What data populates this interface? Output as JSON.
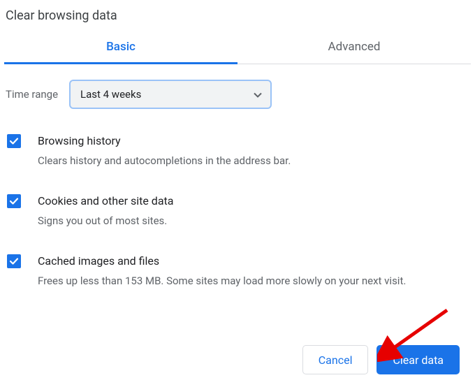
{
  "dialog": {
    "title": "Clear browsing data"
  },
  "tabs": {
    "basic": "Basic",
    "advanced": "Advanced"
  },
  "time": {
    "label": "Time range",
    "value": "Last 4 weeks"
  },
  "options": [
    {
      "label": "Browsing history",
      "description": "Clears history and autocompletions in the address bar."
    },
    {
      "label": "Cookies and other site data",
      "description": "Signs you out of most sites."
    },
    {
      "label": "Cached images and files",
      "description": "Frees up less than 153 MB. Some sites may load more slowly on your next visit."
    }
  ],
  "buttons": {
    "cancel": "Cancel",
    "clear": "Clear data"
  }
}
